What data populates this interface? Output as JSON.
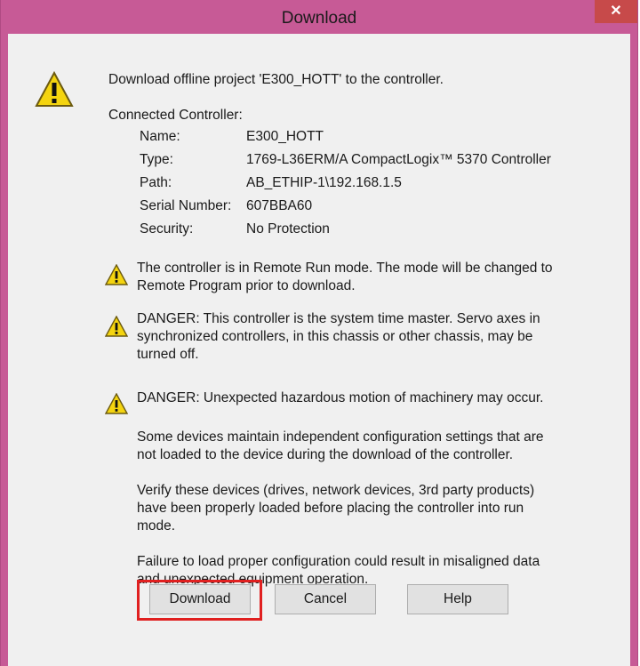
{
  "window": {
    "title": "Download",
    "close_glyph": "✕"
  },
  "intro": "Download offline project 'E300_HOTT' to the controller.",
  "connected": {
    "heading": "Connected Controller:",
    "rows": [
      {
        "label": "Name:",
        "value": "E300_HOTT"
      },
      {
        "label": "Type:",
        "value": "1769-L36ERM/A CompactLogix™ 5370 Controller"
      },
      {
        "label": "Path:",
        "value": "AB_ETHIP-1\\192.168.1.5"
      },
      {
        "label": "Serial Number:",
        "value": "607BBA60"
      },
      {
        "label": "Security:",
        "value": "No Protection"
      }
    ]
  },
  "warnings": [
    {
      "lines": [
        "The controller is in Remote Run mode. The mode will be changed to",
        "Remote Program prior to download."
      ]
    },
    {
      "lines": [
        "DANGER: This controller is the system time master.  Servo axes in",
        "synchronized controllers, in this chassis or other chassis, may be",
        "turned off."
      ]
    },
    {
      "lines": [
        "DANGER: Unexpected hazardous motion of machinery may occur."
      ]
    }
  ],
  "notes": [
    {
      "lines": [
        "Some devices maintain independent configuration settings that are",
        "not loaded to the device during the download of the controller."
      ]
    },
    {
      "lines": [
        "Verify these devices (drives, network devices, 3rd party products)",
        "have been properly loaded before placing the controller into run",
        "mode."
      ]
    },
    {
      "lines": [
        "Failure to load proper configuration could result in misaligned data",
        "and unexpected equipment operation."
      ]
    }
  ],
  "buttons": {
    "download": "Download",
    "cancel": "Cancel",
    "help": "Help"
  },
  "icons": {
    "warning": "warning-icon",
    "close": "close-icon"
  },
  "colors": {
    "titlebar": "#c75a96",
    "close": "#c74a4a",
    "highlight": "#e02020"
  }
}
